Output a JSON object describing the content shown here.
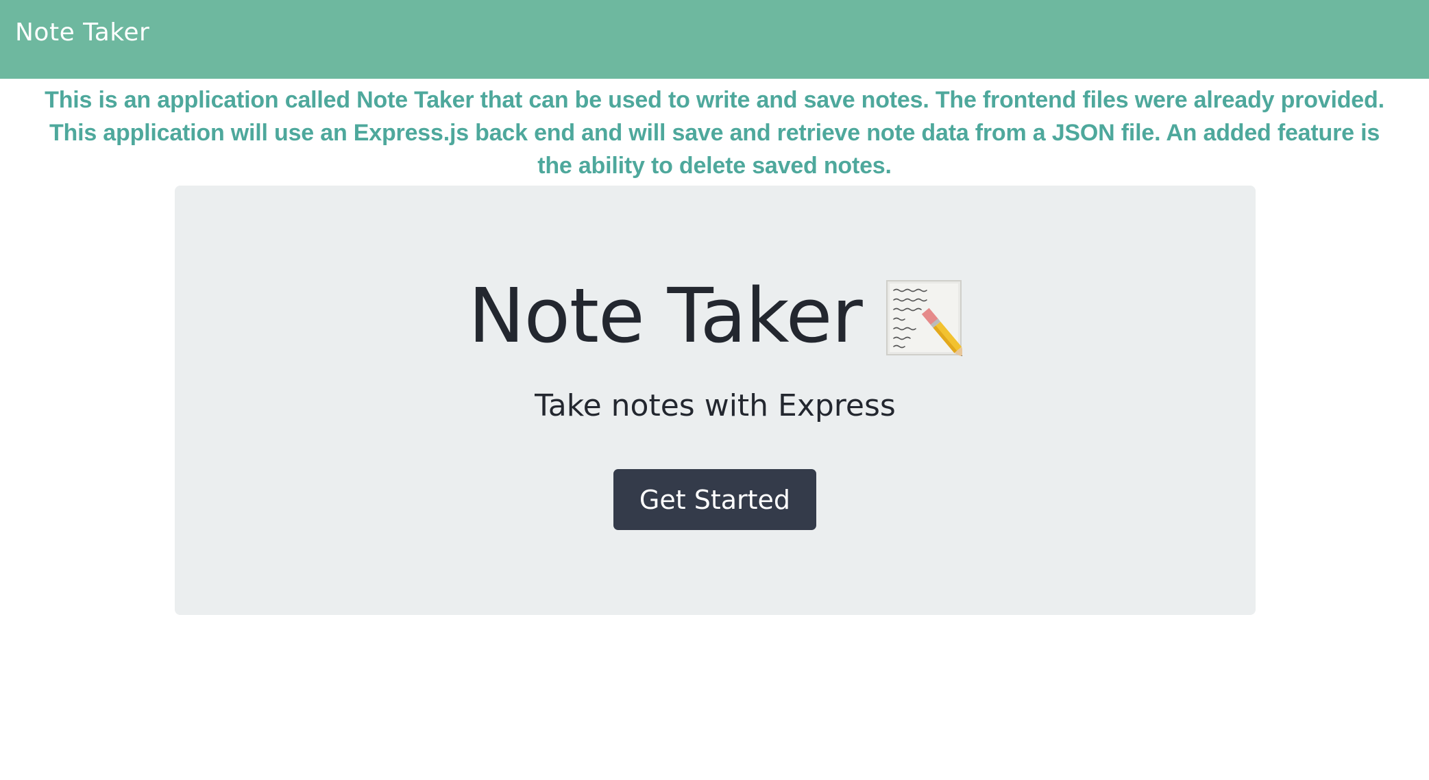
{
  "navbar": {
    "brand": "Note Taker",
    "background": "#6eb89f"
  },
  "description": {
    "text": "This is an application called Note Taker that can be used to write and save notes. The frontend files were already provided. This application will use an Express.js back end and will save and retrieve note data from a JSON file. An added feature is the ability to delete saved notes.",
    "color": "#4ea89c"
  },
  "hero": {
    "title": "Note Taker",
    "icon": "memo-pencil-icon",
    "subtitle": "Take notes with Express",
    "button_label": "Get Started",
    "button_color": "#343b4a",
    "panel_color": "#ebeeef"
  }
}
